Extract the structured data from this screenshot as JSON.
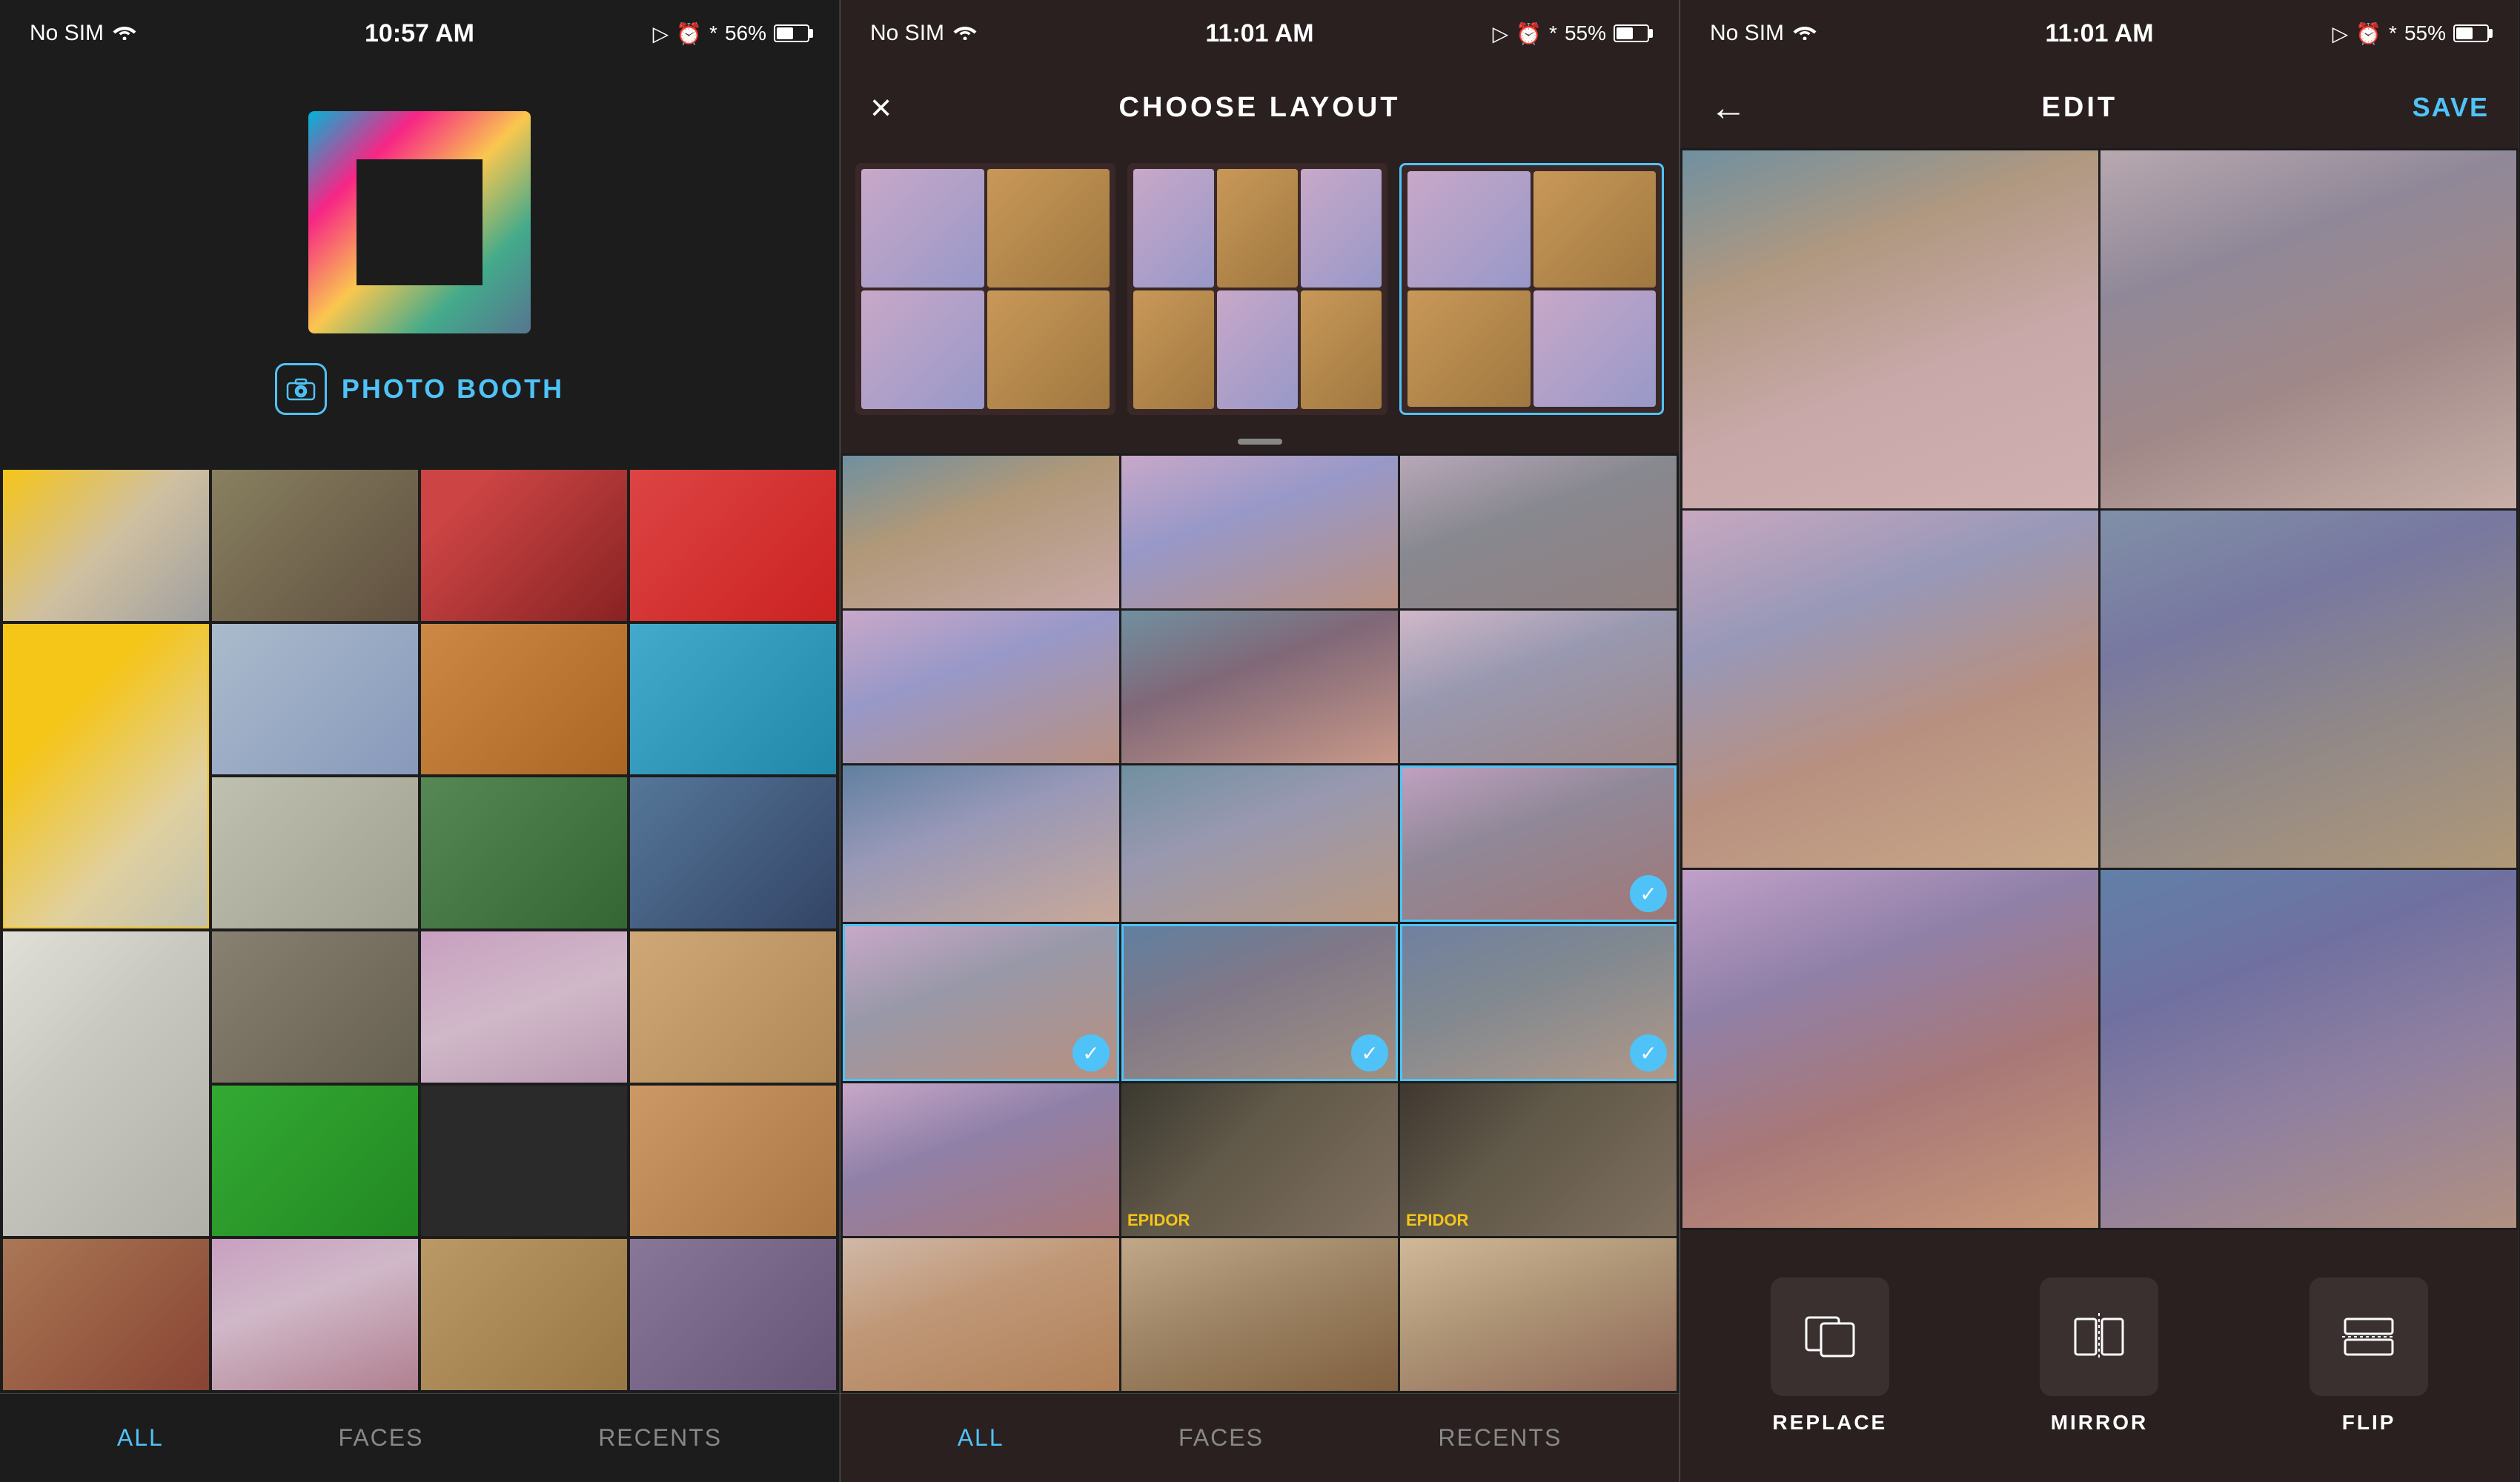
{
  "phone1": {
    "status": {
      "carrier": "No SIM",
      "time": "10:57 AM",
      "battery": "56%",
      "battery_pct": 56
    },
    "logo_app": "PHOTO BOOTH",
    "tabs": [
      {
        "label": "ALL",
        "active": true
      },
      {
        "label": "FACES",
        "active": false
      },
      {
        "label": "RECENTS",
        "active": false
      }
    ]
  },
  "phone2": {
    "status": {
      "carrier": "No SIM",
      "time": "11:01 AM",
      "battery": "55%",
      "battery_pct": 55
    },
    "header": {
      "title": "CHOOSE LAYOUT",
      "close_icon": "×"
    },
    "tabs": [
      {
        "label": "ALL",
        "active": true
      },
      {
        "label": "FACES",
        "active": false
      },
      {
        "label": "RECENTS",
        "active": false
      }
    ]
  },
  "phone3": {
    "status": {
      "carrier": "No SIM",
      "time": "11:01 AM",
      "battery": "55%",
      "battery_pct": 55
    },
    "header": {
      "title": "EDIT",
      "save_label": "SAVE",
      "back_icon": "←"
    },
    "tools": [
      {
        "label": "REPLACE",
        "icon": "replace"
      },
      {
        "label": "MIRROR",
        "icon": "mirror"
      },
      {
        "label": "FLIP",
        "icon": "flip"
      }
    ]
  }
}
